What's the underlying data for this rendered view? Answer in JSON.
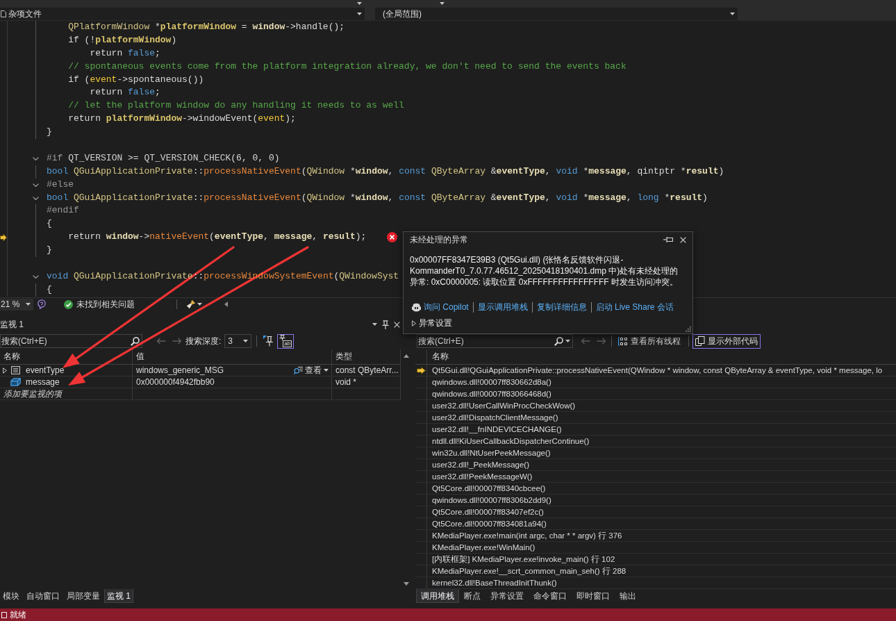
{
  "nav_bar": {
    "project": "杂项文件",
    "scope": "(全局范围)"
  },
  "editor": {
    "lines": [
      {
        "children": [
          {
            "collapsible": false,
            "tokens": [
              {
                "kind": "type",
                "text": "QPlatformWindow"
              },
              {
                "kind": "plain",
                "text": " *"
              },
              {
                "kind": "local",
                "text": "platformWindow"
              },
              {
                "kind": "plain",
                "text": " = "
              },
              {
                "kind": "param",
                "text": "window"
              },
              {
                "kind": "plain",
                "text": "->handle();"
              }
            ]
          },
          {
            "collapsible": false,
            "tokens": [
              {
                "kind": "plain",
                "text": "if (!"
              },
              {
                "kind": "local",
                "text": "platformWindow"
              },
              {
                "kind": "plain",
                "text": ")"
              }
            ],
            "children": [
              {
                "collapsible": false,
                "tokens": [
                  {
                    "kind": "plain",
                    "text": "return "
                  },
                  {
                    "kind": "keyword",
                    "text": "false"
                  },
                  {
                    "kind": "plain",
                    "text": ";"
                  }
                ]
              }
            ]
          },
          {
            "collapsible": false,
            "tokens": [
              {
                "kind": "comment",
                "text": "// spontaneous events come from the platform integration already, we don't need to send the events back"
              }
            ]
          },
          {
            "collapsible": false,
            "tokens": [
              {
                "kind": "plain",
                "text": "if ("
              },
              {
                "kind": "variable",
                "text": "event"
              },
              {
                "kind": "plain",
                "text": "->spontaneous())"
              }
            ],
            "children": [
              {
                "collapsible": false,
                "tokens": [
                  {
                    "kind": "plain",
                    "text": "return "
                  },
                  {
                    "kind": "keyword",
                    "text": "false"
                  },
                  {
                    "kind": "plain",
                    "text": ";"
                  }
                ]
              }
            ]
          },
          {
            "collapsible": false,
            "tokens": [
              {
                "kind": "comment",
                "text": "// let the platform window do any handling it needs to as well"
              }
            ]
          },
          {
            "collapsible": false,
            "tokens": [
              {
                "kind": "plain",
                "text": "return "
              },
              {
                "kind": "local",
                "text": "platformWindow"
              },
              {
                "kind": "plain",
                "text": "->windowEvent("
              },
              {
                "kind": "variable",
                "text": "event"
              },
              {
                "kind": "plain",
                "text": ");"
              }
            ]
          }
        ]
      },
      {
        "collapsible": false,
        "tokens": [
          {
            "kind": "plain",
            "text": "}"
          }
        ]
      },
      {
        "gap_before": true,
        "collapsible": true,
        "tokens": [
          {
            "kind": "directive",
            "text": "#if "
          },
          {
            "kind": "macro",
            "text": "QT_VERSION"
          },
          {
            "kind": "plain",
            "text": " >= "
          },
          {
            "kind": "macro",
            "text": "QT_VERSION_CHECK"
          },
          {
            "kind": "plain",
            "text": "(6, 0, 0)"
          }
        ]
      },
      {
        "collapsible": false,
        "tokens": [
          {
            "kind": "keyword",
            "text": "bool "
          },
          {
            "kind": "type",
            "text": "QGuiApplicationPrivate"
          },
          {
            "kind": "plain",
            "text": "::"
          },
          {
            "kind": "func",
            "text": "processNativeEvent"
          },
          {
            "kind": "plain",
            "text": "("
          },
          {
            "kind": "type",
            "text": "QWindow"
          },
          {
            "kind": "plain",
            "text": " *"
          },
          {
            "kind": "param",
            "text": "window"
          },
          {
            "kind": "plain",
            "text": ", "
          },
          {
            "kind": "keyword",
            "text": "const "
          },
          {
            "kind": "type",
            "text": "QByteArray"
          },
          {
            "kind": "plain",
            "text": " &"
          },
          {
            "kind": "param",
            "text": "eventType"
          },
          {
            "kind": "plain",
            "text": ", "
          },
          {
            "kind": "keyword",
            "text": "void"
          },
          {
            "kind": "plain",
            "text": " *"
          },
          {
            "kind": "param",
            "text": "message"
          },
          {
            "kind": "plain",
            "text": ", qintptr *"
          },
          {
            "kind": "param",
            "text": "result"
          },
          {
            "kind": "plain",
            "text": ")"
          }
        ]
      },
      {
        "collapsible": true,
        "tokens": [
          {
            "kind": "directive",
            "text": "#else"
          }
        ]
      },
      {
        "collapsible": true,
        "tokens": [
          {
            "kind": "keyword",
            "text": "bool "
          },
          {
            "kind": "type",
            "text": "QGuiApplicationPrivate"
          },
          {
            "kind": "plain",
            "text": "::"
          },
          {
            "kind": "func",
            "text": "processNativeEvent"
          },
          {
            "kind": "plain",
            "text": "("
          },
          {
            "kind": "type",
            "text": "QWindow"
          },
          {
            "kind": "plain",
            "text": " *"
          },
          {
            "kind": "param",
            "text": "window"
          },
          {
            "kind": "plain",
            "text": ", "
          },
          {
            "kind": "keyword",
            "text": "const "
          },
          {
            "kind": "type",
            "text": "QByteArray"
          },
          {
            "kind": "plain",
            "text": " &"
          },
          {
            "kind": "param",
            "text": "eventType"
          },
          {
            "kind": "plain",
            "text": ", "
          },
          {
            "kind": "keyword",
            "text": "void"
          },
          {
            "kind": "plain",
            "text": " *"
          },
          {
            "kind": "param",
            "text": "message"
          },
          {
            "kind": "plain",
            "text": ", "
          },
          {
            "kind": "keyword",
            "text": "long"
          },
          {
            "kind": "plain",
            "text": " *"
          },
          {
            "kind": "param",
            "text": "result"
          },
          {
            "kind": "plain",
            "text": ")"
          }
        ]
      },
      {
        "collapsible": false,
        "tokens": [
          {
            "kind": "directive",
            "text": "#endif"
          }
        ]
      },
      {
        "collapsible": false,
        "tokens": [
          {
            "kind": "plain",
            "text": "{"
          }
        ],
        "children": [
          {
            "collapsible": false,
            "current": true,
            "exception": true,
            "tokens": [
              {
                "kind": "plain",
                "text": "return "
              },
              {
                "kind": "param",
                "text": "window"
              },
              {
                "kind": "plain",
                "text": "->"
              },
              {
                "kind": "func",
                "text": "nativeEvent"
              },
              {
                "kind": "plain",
                "text": "("
              },
              {
                "kind": "param",
                "text": "eventType"
              },
              {
                "kind": "plain",
                "text": ", "
              },
              {
                "kind": "param",
                "text": "message"
              },
              {
                "kind": "plain",
                "text": ", "
              },
              {
                "kind": "param",
                "text": "result"
              },
              {
                "kind": "plain",
                "text": ");"
              }
            ]
          }
        ]
      },
      {
        "collapsible": false,
        "tokens": [
          {
            "kind": "plain",
            "text": "}"
          }
        ]
      },
      {
        "gap_before": true,
        "collapsible": true,
        "tokens": [
          {
            "kind": "keyword",
            "text": "void "
          },
          {
            "kind": "type",
            "text": "QGuiApplicationPrivate"
          },
          {
            "kind": "plain",
            "text": "::"
          },
          {
            "kind": "func",
            "text": "processWindowSystemEvent"
          },
          {
            "kind": "plain",
            "text": "("
          },
          {
            "kind": "type",
            "text": "QWindowSyst"
          }
        ]
      },
      {
        "collapsible": false,
        "tokens": [
          {
            "kind": "plain",
            "text": "{"
          }
        ]
      }
    ]
  },
  "editor_status": {
    "zoom": "21 %",
    "issues": "未找到相关问题"
  },
  "exception_popup": {
    "title": "未经处理的异常",
    "message": "0x00007FF8347E39B3 (Qt5Gui.dll) (张恪名反馈软件闪退-KommanderT0_7.0.77.46512_20250418190401.dmp 中)处有未经处理的异常: 0xC0000005: 读取位置 0xFFFFFFFFFFFFFFFF 时发生访问冲突。",
    "actions": [
      {
        "kind": "copilot",
        "label": "询问 Copilot"
      },
      {
        "kind": "link",
        "label": "显示调用堆栈"
      },
      {
        "kind": "link",
        "label": "复制详细信息"
      },
      {
        "kind": "link",
        "label": "启动 Live Share 会话"
      }
    ],
    "settings": {
      "label": "异常设置",
      "expanded": false
    }
  },
  "watch_panel": {
    "title": "监视 1",
    "search": {
      "placeholder": "搜索(Ctrl+E)"
    },
    "nav": [
      {
        "kind": "back",
        "disabled": true
      },
      {
        "kind": "forward",
        "disabled": true
      }
    ],
    "depth_label": "搜索深度:",
    "depth": "3",
    "toggles": [
      {
        "kind": "pin",
        "on": false
      },
      {
        "kind": "pin_label",
        "badge": "ab",
        "on": true
      }
    ],
    "columns": [
      "名称",
      "值",
      "类型"
    ],
    "rows": [
      {
        "kind": "object",
        "expandable": true,
        "expanded": false,
        "name": "eventType",
        "value": "windows_generic_MSG",
        "visualizer": "查看",
        "type": "const QByteArr..."
      },
      {
        "kind": "pointer",
        "expandable": false,
        "name": "message",
        "value": "0x000000f4942fbb90",
        "type": "void *"
      }
    ],
    "add_placeholder": "添加要监视的项",
    "tabs": [
      {
        "label": "模块",
        "selected": false
      },
      {
        "label": "自动窗口",
        "selected": false
      },
      {
        "label": "局部变量",
        "selected": false
      },
      {
        "label": "监视 1",
        "selected": true
      }
    ]
  },
  "call_stack_panel": {
    "search": {
      "placeholder": "搜索(Ctrl+E)"
    },
    "nav": [
      {
        "kind": "back",
        "disabled": true
      },
      {
        "kind": "forward",
        "disabled": true
      }
    ],
    "toggles": [
      {
        "kind": "threads",
        "label": "查看所有线程",
        "on": false
      },
      {
        "kind": "external",
        "label": "显示外部代码",
        "on": true
      }
    ],
    "columns": [
      "名称"
    ],
    "frames": [
      {
        "text": "Qt5Gui.dll!QGuiApplicationPrivate::processNativeEvent(QWindow * window, const QByteArray & eventType, void * message, lo",
        "current": true
      },
      {
        "text": "qwindows.dll!00007ff830662d8a()",
        "current": false
      },
      {
        "text": "qwindows.dll!00007ff83066468d()",
        "current": false
      },
      {
        "text": "user32.dll!UserCallWinProcCheckWow()",
        "current": false
      },
      {
        "text": "user32.dll!DispatchClientMessage()",
        "current": false
      },
      {
        "text": "user32.dll!__fnINDEVICECHANGE()",
        "current": false
      },
      {
        "text": "ntdll.dll!KiUserCallbackDispatcherContinue()",
        "current": false
      },
      {
        "text": "win32u.dll!NtUserPeekMessage()",
        "current": false
      },
      {
        "text": "user32.dll!_PeekMessage()",
        "current": false
      },
      {
        "text": "user32.dll!PeekMessageW()",
        "current": false
      },
      {
        "text": "Qt5Core.dll!00007ff8340cbcee()",
        "current": false
      },
      {
        "text": "qwindows.dll!00007ff8306b2dd9()",
        "current": false
      },
      {
        "text": "Qt5Core.dll!00007ff83407ef2c()",
        "current": false
      },
      {
        "text": "Qt5Core.dll!00007ff834081a94()",
        "current": false
      },
      {
        "text": "KMediaPlayer.exe!main(int argc, char * * argv) 行 376",
        "current": false
      },
      {
        "text": "KMediaPlayer.exe!WinMain()",
        "current": false
      },
      {
        "text": "[内联框架] KMediaPlayer.exe!invoke_main() 行 102",
        "current": false
      },
      {
        "text": "KMediaPlayer.exe!__scrt_common_main_seh() 行 288",
        "current": false
      },
      {
        "text": "kernel32.dll!BaseThreadInitThunk()",
        "current": false
      }
    ],
    "tabs": [
      {
        "label": "调用堆栈",
        "selected": true
      },
      {
        "label": "断点",
        "selected": false
      },
      {
        "label": "异常设置",
        "selected": false
      },
      {
        "label": "命令窗口",
        "selected": false
      },
      {
        "label": "即时窗口",
        "selected": false
      },
      {
        "label": "输出",
        "selected": false
      }
    ]
  },
  "status_bar": {
    "text": "就绪"
  },
  "annotations": [
    {
      "kind": "arrow"
    },
    {
      "kind": "arrow"
    }
  ]
}
